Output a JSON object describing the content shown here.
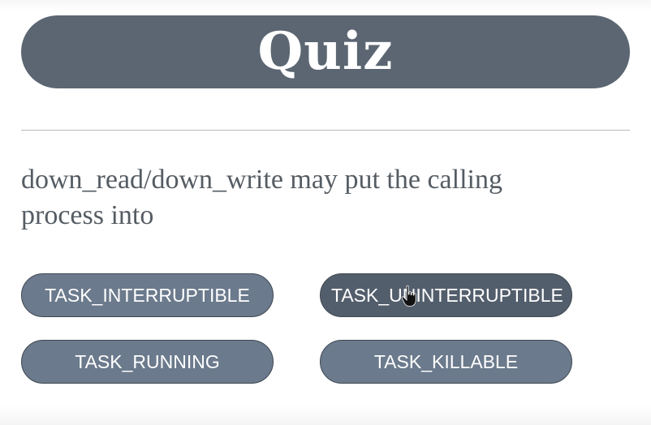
{
  "quiz": {
    "title": "Quiz",
    "question": "down_read/down_write may put the calling process into",
    "answers": [
      "TASK_INTERRUPTIBLE",
      "TASK_UNINTERRUPTIBLE",
      "TASK_RUNNING",
      "TASK_KILLABLE"
    ]
  },
  "colors": {
    "header_bg": "#5b6672",
    "answer_bg": "#6b7a8c",
    "answer_hover_bg": "#535e6c",
    "question_text": "#555c63"
  },
  "icons": {
    "cursor": "hand-pointer-icon"
  }
}
